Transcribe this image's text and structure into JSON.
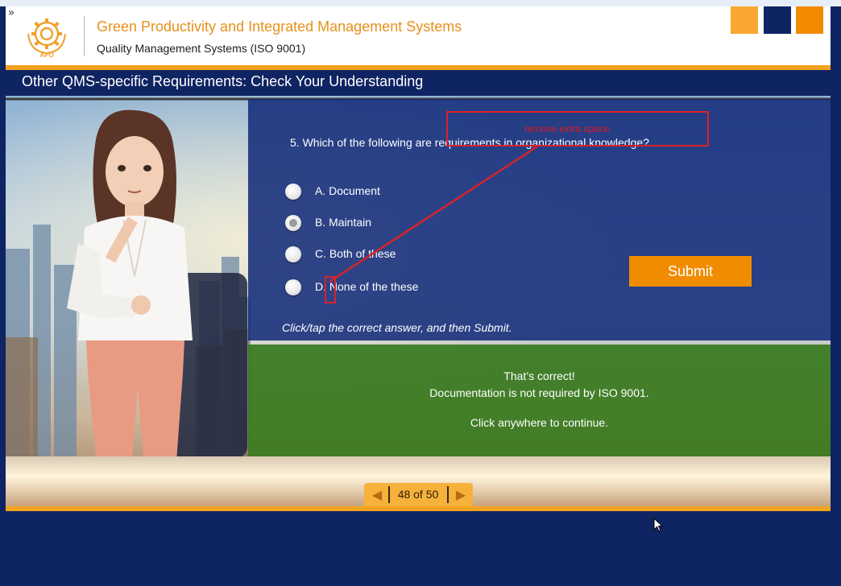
{
  "header": {
    "course_title": "Green Productivity and Integrated Management Systems",
    "course_subtitle": "Quality Management Systems (ISO 9001)",
    "logo_text": "APO",
    "squares": [
      "#f8a830",
      "#0f2462",
      "#f28b00"
    ]
  },
  "slide": {
    "title": "Other QMS-specific Requirements: Check Your Understanding"
  },
  "question": {
    "text": "5. Which of the following are requirements in organizational knowledge?",
    "options": [
      {
        "label": "A.  Document",
        "selected": false
      },
      {
        "label": "B.  Maintain",
        "selected": true
      },
      {
        "label": "C.  Both of these",
        "selected": false
      },
      {
        "label": "D.  None of the these",
        "selected": false
      }
    ],
    "submit_label": "Submit",
    "instruction": "Click/tap the correct answer, and then Submit."
  },
  "feedback": {
    "line1": "That’s correct!",
    "line2": "Documentation is not required by ISO 9001.",
    "line3": "Click anywhere to continue."
  },
  "annotation": {
    "text": "remove extra space"
  },
  "navigation": {
    "counter": "48 of 50",
    "prev_icon": "triangle-left-icon",
    "next_icon": "triangle-right-icon"
  },
  "colors": {
    "brand_orange": "#f4a320",
    "navy": "#0f2462",
    "feedback_green": "#34781c",
    "annotation_red": "#d8232a"
  }
}
